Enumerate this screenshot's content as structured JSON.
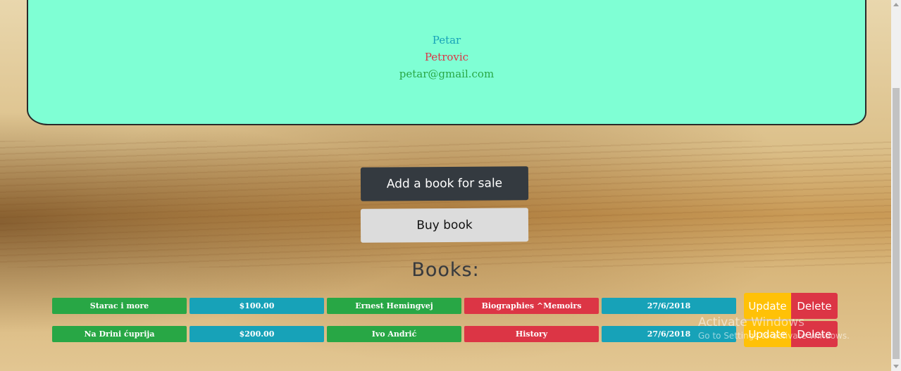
{
  "profile": {
    "first_name": "Petar",
    "last_name": "Petrovic",
    "email": "petar@gmail.com"
  },
  "actions": {
    "add_book_label": "Add a book for sale",
    "buy_book_label": "Buy book"
  },
  "books_heading": "Books:",
  "books": [
    {
      "title": "Starac i more",
      "price": "$100.00",
      "author": "Ernest Hemingvej",
      "category": "Biographies ^Memoirs",
      "date": "27/6/2018",
      "update_label": "Update",
      "delete_label": "Delete"
    },
    {
      "title": "Na Drini ćuprija",
      "price": "$200.00",
      "author": "Ivo Andrić",
      "category": "History",
      "date": "27/6/2018",
      "update_label": "Update",
      "delete_label": "Delete"
    }
  ],
  "watermark": {
    "title": "Activate Windows",
    "subtitle": "Go to Settings to activate Windows."
  },
  "colors": {
    "card_bg": "#7fffd4",
    "green": "#28a745",
    "teal": "#17a2b8",
    "red": "#dc3545",
    "yellow": "#ffc107",
    "dark_button": "#343a40",
    "light_button": "#dcdcdc"
  }
}
